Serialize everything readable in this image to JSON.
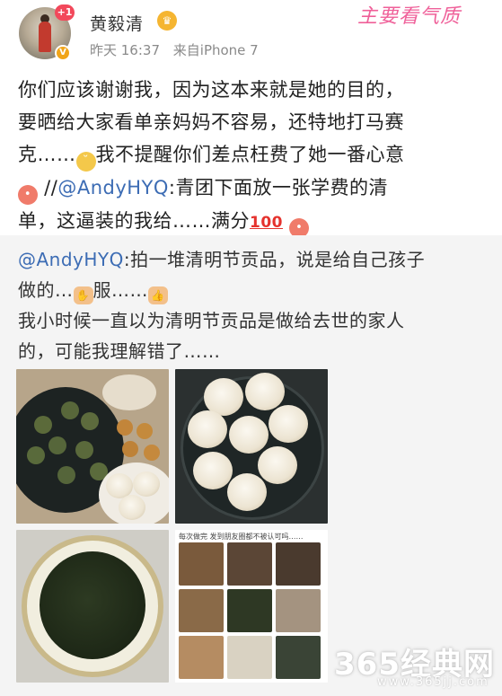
{
  "header": {
    "username": "黄毅清",
    "notification_badge": "+1",
    "verified_mark": "V",
    "crown_badge": "♛",
    "time": "昨天 16:37",
    "source": "来自iPhone 7",
    "watermark": "主要看气质"
  },
  "post": {
    "line1": "你们应该谢谢我，因为这本来就是她的目的，",
    "line2": "要晒给大家看单亲妈妈不容易，还特地打马赛",
    "line3_a": "克……",
    "line3_b": "我不提醒你们差点枉费了她一番心意",
    "line4_a": " //",
    "line4_mention": "@AndyHYQ",
    "line4_b": ":青团下面放一张学费的清",
    "line5_a": "单，这逼装的我给……满分",
    "score_emoji": "100"
  },
  "repost": {
    "mention": "@AndyHYQ",
    "line1_rest": ":拍一堆清明节贡品，说是给自己孩子",
    "line2_a": "做的…",
    "line2_b": "服……",
    "line3": "我小时候一直以为清明节贡品是做给去世的家人",
    "line4": "的，可能我理解错了……"
  },
  "photos": {
    "grid_caption": "每次做完 发到朋友圈都不被认可吗……"
  },
  "watermarks": {
    "brand": "365经典网",
    "site": "www.365jj.com"
  }
}
